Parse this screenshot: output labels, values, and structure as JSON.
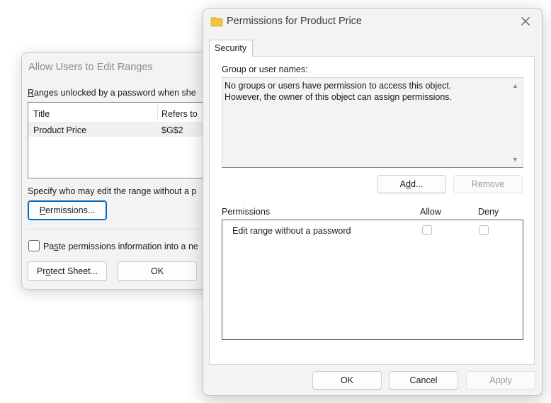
{
  "back_dialog": {
    "title": "Allow Users to Edit Ranges",
    "ranges_label_prefix": "R",
    "ranges_label_rest": "anges unlocked by a password when she",
    "columns": [
      "Title",
      "Refers to"
    ],
    "rows": [
      {
        "title": "Product Price",
        "refers_to": "$G$2"
      }
    ],
    "specify_label": "Specify who may edit the range without a p",
    "permissions_button": {
      "mnemonic": "P",
      "rest": "ermissions..."
    },
    "paste_checkbox": {
      "checked": false,
      "prefix": "Pa",
      "mnemonic": "s",
      "rest": "te permissions information into a ne"
    },
    "protect_button": {
      "prefix": "Pr",
      "mnemonic": "o",
      "rest": "tect Sheet..."
    },
    "ok_button": "OK"
  },
  "front_dialog": {
    "title": "Permissions for Product Price",
    "tabs": [
      {
        "label": "Security",
        "active": true
      }
    ],
    "group_label": "Group or user names:",
    "group_message_line1": "No groups or users have permission to access this object.",
    "group_message_line2": "However, the owner of this object can assign permissions.",
    "add_button": {
      "prefix": "A",
      "mnemonic": "d",
      "rest": "d..."
    },
    "remove_button": "Remove",
    "permissions_header": {
      "label": "Permissions",
      "allow": "Allow",
      "deny": "Deny"
    },
    "permissions": [
      {
        "label": "Edit range without a password",
        "allow": false,
        "deny": false
      }
    ],
    "ok_button": "OK",
    "cancel_button": "Cancel",
    "apply_button": "Apply"
  },
  "colors": {
    "accent": "#0067c0",
    "folder": "#f6c443"
  }
}
